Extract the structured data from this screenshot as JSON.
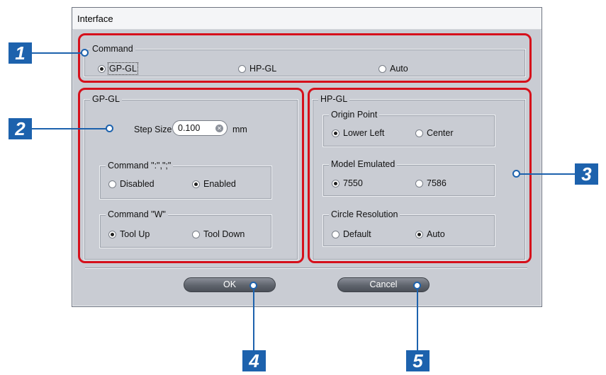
{
  "dialog": {
    "title": "Interface",
    "command": {
      "label": "Command",
      "options": [
        "GP-GL",
        "HP-GL",
        "Auto"
      ],
      "selected": "GP-GL"
    },
    "gpgl": {
      "label": "GP-GL",
      "step_size_label": "Step Size",
      "step_size_value": "0.100",
      "step_size_unit": "mm",
      "command_colon": {
        "label": "Command \":\",\";\"",
        "options": [
          "Disabled",
          "Enabled"
        ],
        "selected": "Enabled"
      },
      "command_w": {
        "label": "Command \"W\"",
        "options": [
          "Tool Up",
          "Tool Down"
        ],
        "selected": "Tool Up"
      }
    },
    "hpgl": {
      "label": "HP-GL",
      "origin_point": {
        "label": "Origin Point",
        "options": [
          "Lower Left",
          "Center"
        ],
        "selected": "Lower Left"
      },
      "model_emulated": {
        "label": "Model Emulated",
        "options": [
          "7550",
          "7586"
        ],
        "selected": "7550"
      },
      "circle_resolution": {
        "label": "Circle Resolution",
        "options": [
          "Default",
          "Auto"
        ],
        "selected": "Auto"
      }
    },
    "buttons": {
      "ok": "OK",
      "cancel": "Cancel"
    }
  },
  "callouts": [
    "1",
    "2",
    "3",
    "4",
    "5"
  ],
  "colors": {
    "callout_box": "#d6101b",
    "callout_badge": "#1d62ad",
    "dialog_bg": "#c9ccd3"
  }
}
